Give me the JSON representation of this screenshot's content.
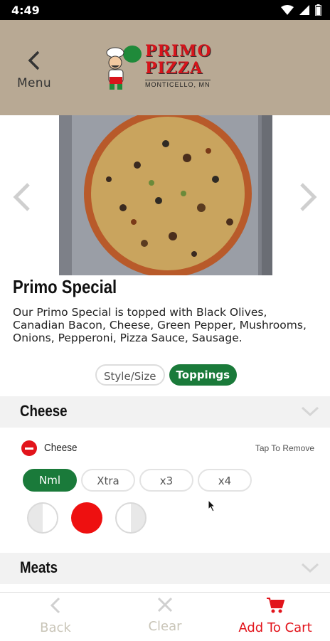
{
  "status_bar": {
    "time": "4:49"
  },
  "header": {
    "menu_label": "Menu",
    "logo": {
      "brand_line1": "PRIMO",
      "brand_line2": "PIZZA",
      "location": "MONTICELLO, MN"
    }
  },
  "product": {
    "title": "Primo Special",
    "description": "Our Primo Special is topped with Black Olives, Canadian Bacon, Cheese, Green Pepper, Mushrooms, Onions, Pepperoni, Pizza Sauce, Sausage."
  },
  "tabs": [
    {
      "label": "Style/Size",
      "active": false
    },
    {
      "label": "Toppings",
      "active": true
    }
  ],
  "sections": {
    "cheese": {
      "title": "Cheese",
      "item_name": "Cheese",
      "tap_hint": "Tap To Remove",
      "quantities": [
        "Nml",
        "Xtra",
        "x3",
        "x4"
      ],
      "selected_quantity": "Nml",
      "coverage_selected": "whole"
    },
    "meats": {
      "title": "Meats"
    }
  },
  "bottom_nav": {
    "back": "Back",
    "clear": "Clear",
    "add_to_cart": "Add To Cart"
  },
  "colors": {
    "header_bg": "#b8a994",
    "accent_green": "#1a7a3a",
    "accent_red": "#e2141b",
    "cart_red": "#e2141b"
  }
}
